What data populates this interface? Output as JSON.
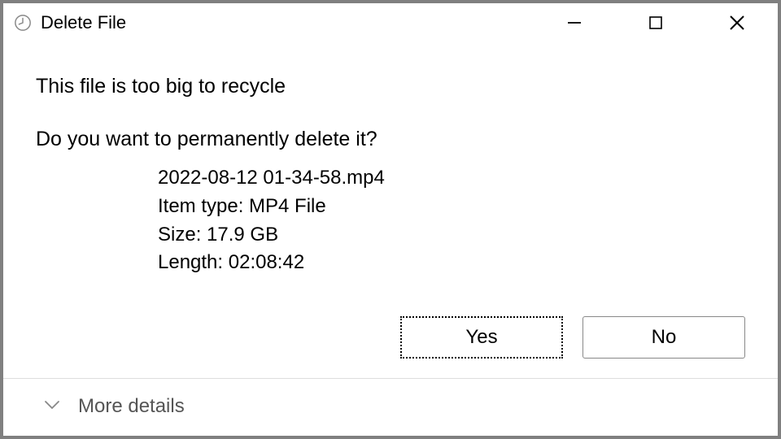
{
  "titlebar": {
    "title": "Delete File"
  },
  "content": {
    "heading": "This file is too big to recycle",
    "question": "Do you want to permanently delete it?",
    "file": {
      "name": "2022-08-12 01-34-58.mp4",
      "type_label": "Item type: MP4 File",
      "size_label": "Size: 17.9 GB",
      "length_label": "Length: 02:08:42"
    }
  },
  "buttons": {
    "yes": "Yes",
    "no": "No"
  },
  "footer": {
    "more_details": "More details"
  }
}
